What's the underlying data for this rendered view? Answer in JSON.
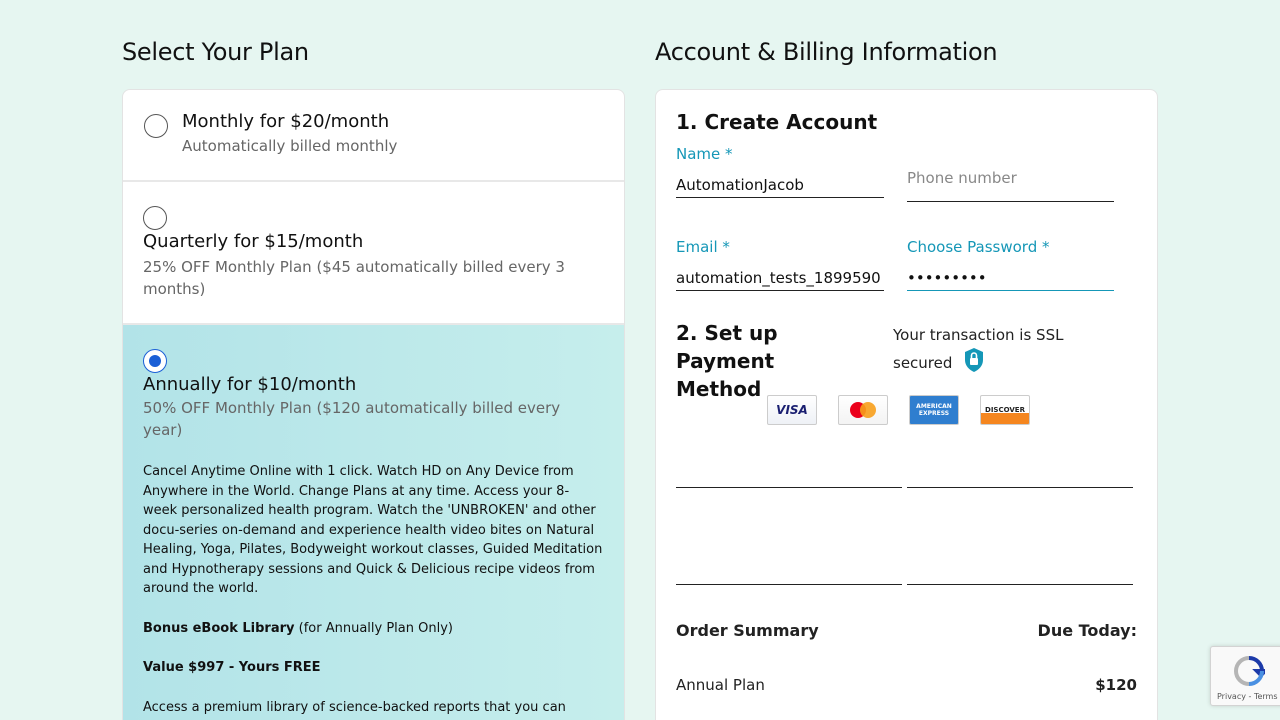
{
  "plans_column": {
    "title": "Select Your Plan",
    "plans": [
      {
        "name": "Monthly for $20/month",
        "sub": "Automatically billed monthly",
        "selected": false
      },
      {
        "name": "Quarterly for $15/month",
        "sub": "25% OFF Monthly Plan ($45 automatically billed every 3 months)",
        "selected": false
      },
      {
        "name": "Annually for $10/month",
        "sub": "50% OFF Monthly Plan ($120 automatically billed every year)",
        "selected": true,
        "description": "Cancel Anytime Online with 1 click. Watch HD on Any Device from Anywhere in the World. Change Plans at any time. Access your 8-week personalized health program. Watch the 'UNBROKEN' and other docu-series on-demand and experience health video bites on Natural Healing, Yoga, Pilates, Bodyweight workout classes, Guided Meditation and Hypnotherapy sessions and Quick & Delicious recipe videos from around the world.",
        "bonus_bold": "Bonus eBook Library",
        "bonus_rest": " (for Annually Plan Only)",
        "value_line": "Value $997 - Yours FREE",
        "access_text": "Access a premium library of science-backed reports that you can"
      }
    ]
  },
  "billing_column": {
    "title": "Account & Billing Information",
    "create_account": {
      "heading": "1. Create Account",
      "name_label": "Name *",
      "name_value": "AutomationJacob",
      "phone_placeholder": "Phone number",
      "email_label": "Email *",
      "email_value": "automation_tests_1899590",
      "password_label": "Choose Password *",
      "password_value": "•••••••••"
    },
    "payment": {
      "heading": "2. Set up Payment Method",
      "ssl_text": "Your transaction is SSL secured",
      "cards": [
        "VISA",
        "MasterCard",
        "AMERICAN EXPRESS",
        "DISCOVER"
      ]
    },
    "order_summary": {
      "title": "Order Summary",
      "due_label": "Due Today:",
      "line_label": "Annual Plan",
      "line_value": "$120"
    }
  },
  "recaptcha": {
    "footer": "Privacy - Terms"
  },
  "colors": {
    "accent": "#1597b7",
    "radio_selected": "#1a5fd6",
    "selected_plan_bg": "#bce9ea",
    "page_bg": "#e6f6f1"
  }
}
